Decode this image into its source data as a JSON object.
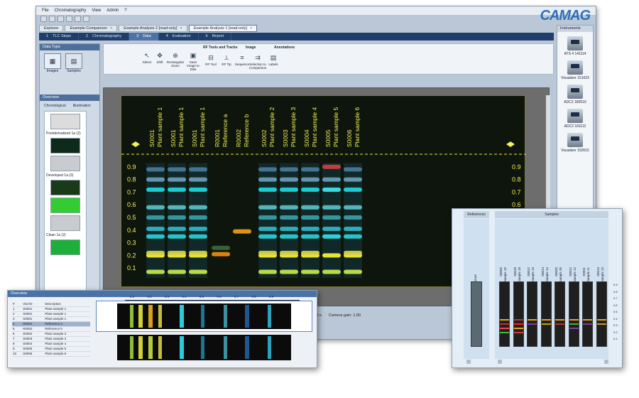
{
  "menu": [
    "File",
    "Chromatography",
    "View",
    "Admin",
    "?"
  ],
  "brand": "CAMAG",
  "doc_tabs": [
    {
      "label": "Explorer"
    },
    {
      "label": "Example Comparison",
      "close": "×"
    },
    {
      "label": "Example Analysis 2 [read-only]",
      "close": "×"
    },
    {
      "label": "Example Analysis 1 [read-only]",
      "close": "×",
      "active": true
    }
  ],
  "steps": [
    {
      "num": "1",
      "label": "TLC Steps"
    },
    {
      "num": "2",
      "label": "Chromatography"
    },
    {
      "num": "3",
      "label": "Data",
      "active": true
    },
    {
      "num": "4",
      "label": "Evaluation"
    },
    {
      "num": "5",
      "label": "Report"
    }
  ],
  "left_panel": {
    "data_type_title": "Data Type",
    "images_label": "Images",
    "samples_label": "Samples",
    "overview_title": "Overview",
    "tab_chronological": "Chronological",
    "tab_illumination": "Illumination",
    "thumbs": [
      {
        "label": "",
        "color": "#dcdcdc"
      },
      {
        "label": "Postderivatized 1a (2)",
        "color": "#0e2a1a"
      },
      {
        "label": "",
        "color": "#c8ccd0"
      },
      {
        "label": "Developed 1a (3)",
        "color": "#1a3a1a"
      },
      {
        "label": "",
        "color": "#33cc33"
      },
      {
        "label": "",
        "color": "#c8ccd0"
      },
      {
        "label": "Clean 1a (2)",
        "color": "#1fae3a"
      }
    ]
  },
  "toolbar": {
    "groups": [
      "RF Tools and Tracks",
      "Image",
      "Annotations"
    ],
    "buttons": [
      {
        "label": "Select",
        "icon": "↖"
      },
      {
        "label": "Shift",
        "icon": "✥"
      },
      {
        "label": "Rectangular Zoom",
        "icon": "⊕"
      },
      {
        "label": "Save Image to Disk",
        "icon": "▣"
      },
      {
        "label": "RF Tool",
        "icon": "⊟"
      },
      {
        "label": "RF Tip",
        "icon": "⟂"
      },
      {
        "label": "Sequence",
        "icon": "≡"
      },
      {
        "label": "Selection to Comparison",
        "icon": "⇉"
      },
      {
        "label": "Labels",
        "icon": "▤"
      }
    ]
  },
  "plate": {
    "tracks": [
      {
        "line1": "S0001",
        "line2": "Plant sample 1"
      },
      {
        "line1": "S0001",
        "line2": "Plant sample 1"
      },
      {
        "line1": "S0001",
        "line2": "Plant sample 1"
      },
      {
        "line1": "R0001",
        "line2": "Reference a"
      },
      {
        "line1": "R0002",
        "line2": "Reference b"
      },
      {
        "line1": "S0002",
        "line2": "Plant sample 2"
      },
      {
        "line1": "S0003",
        "line2": "Plant sample 3"
      },
      {
        "line1": "S0004",
        "line2": "Plant sample 4"
      },
      {
        "line1": "S0005",
        "line2": "Plant sample 5"
      },
      {
        "line1": "S0006",
        "line2": "Plant sample 6"
      }
    ],
    "rf_ticks": [
      "0.9",
      "0.8",
      "0.7",
      "0.6",
      "0.5",
      "0.4",
      "0.3",
      "0.2",
      "0.1"
    ]
  },
  "status": {
    "exposure": "sure: 0.000 s",
    "camera_gain": "Camera gain: 1.00"
  },
  "instruments": {
    "title": "Instruments",
    "items": [
      "ATS 4 141114",
      "Visualizer 151023",
      "ADC2 180519",
      "ADC2 181112",
      "Visualizer 150515"
    ]
  },
  "overview_popup": {
    "title": "Overview",
    "columns": [
      "#",
      "Vial ID",
      "Description"
    ],
    "rows": [
      [
        "1",
        "S0001",
        "Plant sample 1"
      ],
      [
        "2",
        "S0001",
        "Plant sample 1"
      ],
      [
        "3",
        "S0001",
        "Plant sample 1"
      ],
      [
        "4",
        "R0001",
        "Reference a"
      ],
      [
        "5",
        "R0002",
        "Reference b"
      ],
      [
        "6",
        "S0002",
        "Plant sample 2"
      ],
      [
        "7",
        "S0003",
        "Plant sample 3"
      ],
      [
        "8",
        "S0004",
        "Plant sample 4"
      ],
      [
        "9",
        "S0005",
        "Plant sample 5"
      ],
      [
        "10",
        "S0006",
        "Plant sample 6"
      ]
    ],
    "selected_row": 3,
    "scale": [
      "0.1",
      "0.2",
      "0.3",
      "0.4",
      "0.5",
      "0.6",
      "0.7",
      "0.8",
      "0.9"
    ]
  },
  "samples_popup": {
    "references_header": "References",
    "samples_header": "Samples",
    "reference": "Mixture",
    "samples": [
      {
        "line1": "S0005",
        "line2": "Sample 10"
      },
      {
        "line1": "S0018",
        "line2": "Sample 18"
      },
      {
        "line1": "S0012",
        "line2": "Sample 13"
      },
      {
        "line1": "S0014",
        "line2": "Sample 14"
      },
      {
        "line1": "S0020",
        "line2": "Sample 20"
      },
      {
        "line1": "S0012",
        "line2": "Sample 12"
      },
      {
        "line1": "S0011",
        "line2": "Sample 11"
      },
      {
        "line1": "S0013",
        "line2": "Sample 13"
      }
    ],
    "ticks": [
      "0.9",
      "0.8",
      "0.7",
      "0.6",
      "0.5",
      "0.4",
      "0.3",
      "0.2",
      "0.1"
    ]
  }
}
